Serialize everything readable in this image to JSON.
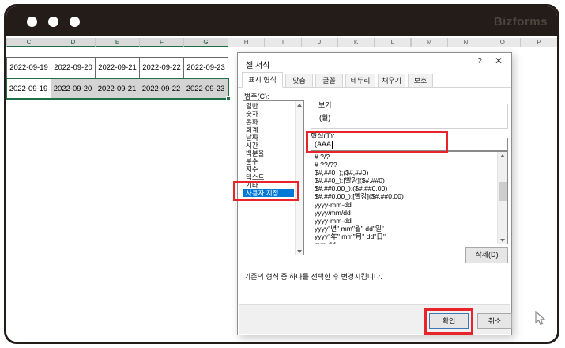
{
  "window": {
    "brand": "Bizforms"
  },
  "spreadsheet": {
    "columns": [
      "C",
      "D",
      "E",
      "F",
      "G",
      "H",
      "I",
      "J",
      "K",
      "L",
      "M",
      "N",
      "O",
      "P"
    ],
    "selected_columns": [
      "C",
      "D",
      "E",
      "F",
      "G"
    ],
    "rows": [
      {
        "selected": false,
        "cells": [
          "2022-09-19",
          "2022-09-20",
          "2022-09-21",
          "2022-09-22",
          "2022-09-23"
        ]
      },
      {
        "selected": true,
        "cells": [
          "2022-09-19",
          "2022-09-20",
          "2022-09-21",
          "2022-09-22",
          "2022-09-23"
        ]
      }
    ]
  },
  "dialog": {
    "title": "셀 서식",
    "help_button": "?",
    "close_button": "✕",
    "tabs": [
      {
        "label": "표시 형식",
        "active": true
      },
      {
        "label": "맞춤",
        "active": false
      },
      {
        "label": "글꼴",
        "active": false
      },
      {
        "label": "테두리",
        "active": false
      },
      {
        "label": "채우기",
        "active": false
      },
      {
        "label": "보호",
        "active": false
      }
    ],
    "category": {
      "label": "범주(C):",
      "items": [
        "일반",
        "숫자",
        "통화",
        "회계",
        "날짜",
        "시간",
        "백분율",
        "분수",
        "지수",
        "텍스트",
        "기타",
        "사용자 지정"
      ],
      "selected": "사용자 지정"
    },
    "preview": {
      "label": "보기",
      "value": "(월)"
    },
    "format_field": {
      "label": "형식(T):",
      "value": "(AAA"
    },
    "format_list": [
      "# ?/?",
      "# ??/??",
      "$#,##0_);($#,##0)",
      "$#,##0_);[빨강]($#,##0)",
      "$#,##0.00_);($#,##0.00)",
      "$#,##0.00_);[빨강]($#,##0.00)",
      "yyyy-mm-dd",
      "yyyy/mm/dd",
      "yyyy-mm-dd",
      "yyyy\"년\" mm\"월\" dd\"일\"",
      "yyyy\"年\" mm\"月\" dd\"日\"",
      "mm-dd"
    ],
    "delete_button": "삭제(D)",
    "help_text": "기존의 형식 중 하나를 선택한 후 변경시킵니다.",
    "ok_button": "확인",
    "cancel_button": "취소"
  },
  "colors": {
    "titlebar": "#241c18",
    "selection_green": "#1e7145",
    "selection_blue": "#0078d7",
    "annotation_red": "#e8232a"
  }
}
